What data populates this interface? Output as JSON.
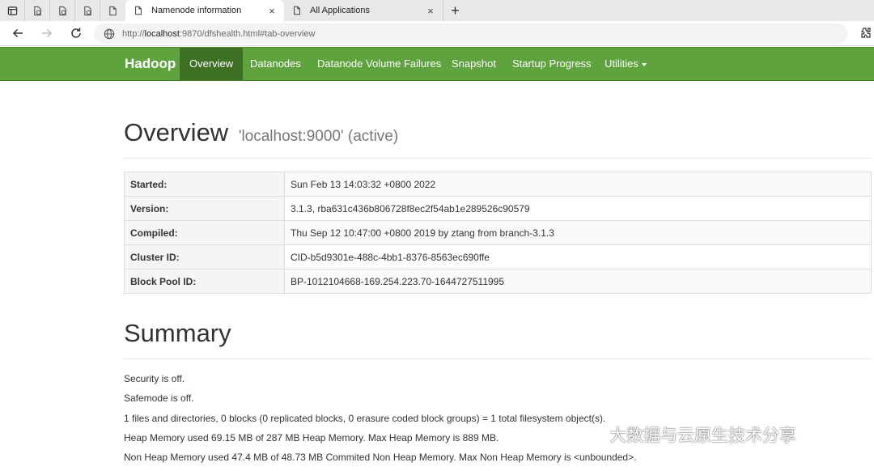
{
  "browser": {
    "tabs": [
      {
        "label": "Namenode information",
        "active": true
      },
      {
        "label": "All Applications",
        "active": false
      }
    ],
    "close_glyph": "×",
    "newtab_glyph": "+",
    "url": {
      "scheme": "http://",
      "host": "localhost",
      "rest": ":9870/dfshealth.html#tab-overview"
    }
  },
  "navbar": {
    "brand": "Hadoop",
    "items": [
      {
        "label": "Overview",
        "active": true
      },
      {
        "label": "Datanodes"
      },
      {
        "label": "Datanode Volume Failures"
      },
      {
        "label": "Snapshot"
      },
      {
        "label": "Startup Progress"
      },
      {
        "label": "Utilities"
      }
    ],
    "color": "#5fa33e",
    "active_color": "#3d6f24"
  },
  "overview": {
    "title": "Overview",
    "subtitle": "'localhost:9000' (active)",
    "rows": [
      {
        "key": "Started:",
        "value": "Sun Feb 13 14:03:32 +0800 2022"
      },
      {
        "key": "Version:",
        "value": "3.1.3, rba631c436b806728f8ec2f54ab1e289526c90579"
      },
      {
        "key": "Compiled:",
        "value": "Thu Sep 12 10:47:00 +0800 2019 by ztang from branch-3.1.3"
      },
      {
        "key": "Cluster ID:",
        "value": "CID-b5d9301e-488c-4bb1-8376-8563ec690ffe"
      },
      {
        "key": "Block Pool ID:",
        "value": "BP-1012104668-169.254.223.70-1644727511995"
      }
    ]
  },
  "summary": {
    "title": "Summary",
    "lines": [
      "Security is off.",
      "Safemode is off.",
      "1 files and directories, 0 blocks (0 replicated blocks, 0 erasure coded block groups) = 1 total filesystem object(s).",
      "Heap Memory used 69.15 MB of 287 MB Heap Memory. Max Heap Memory is 889 MB.",
      "Non Heap Memory used 47.4 MB of 48.73 MB Commited Non Heap Memory. Max Non Heap Memory is <unbounded>."
    ]
  },
  "watermark": {
    "text": "大数据与云原生技术分享"
  }
}
